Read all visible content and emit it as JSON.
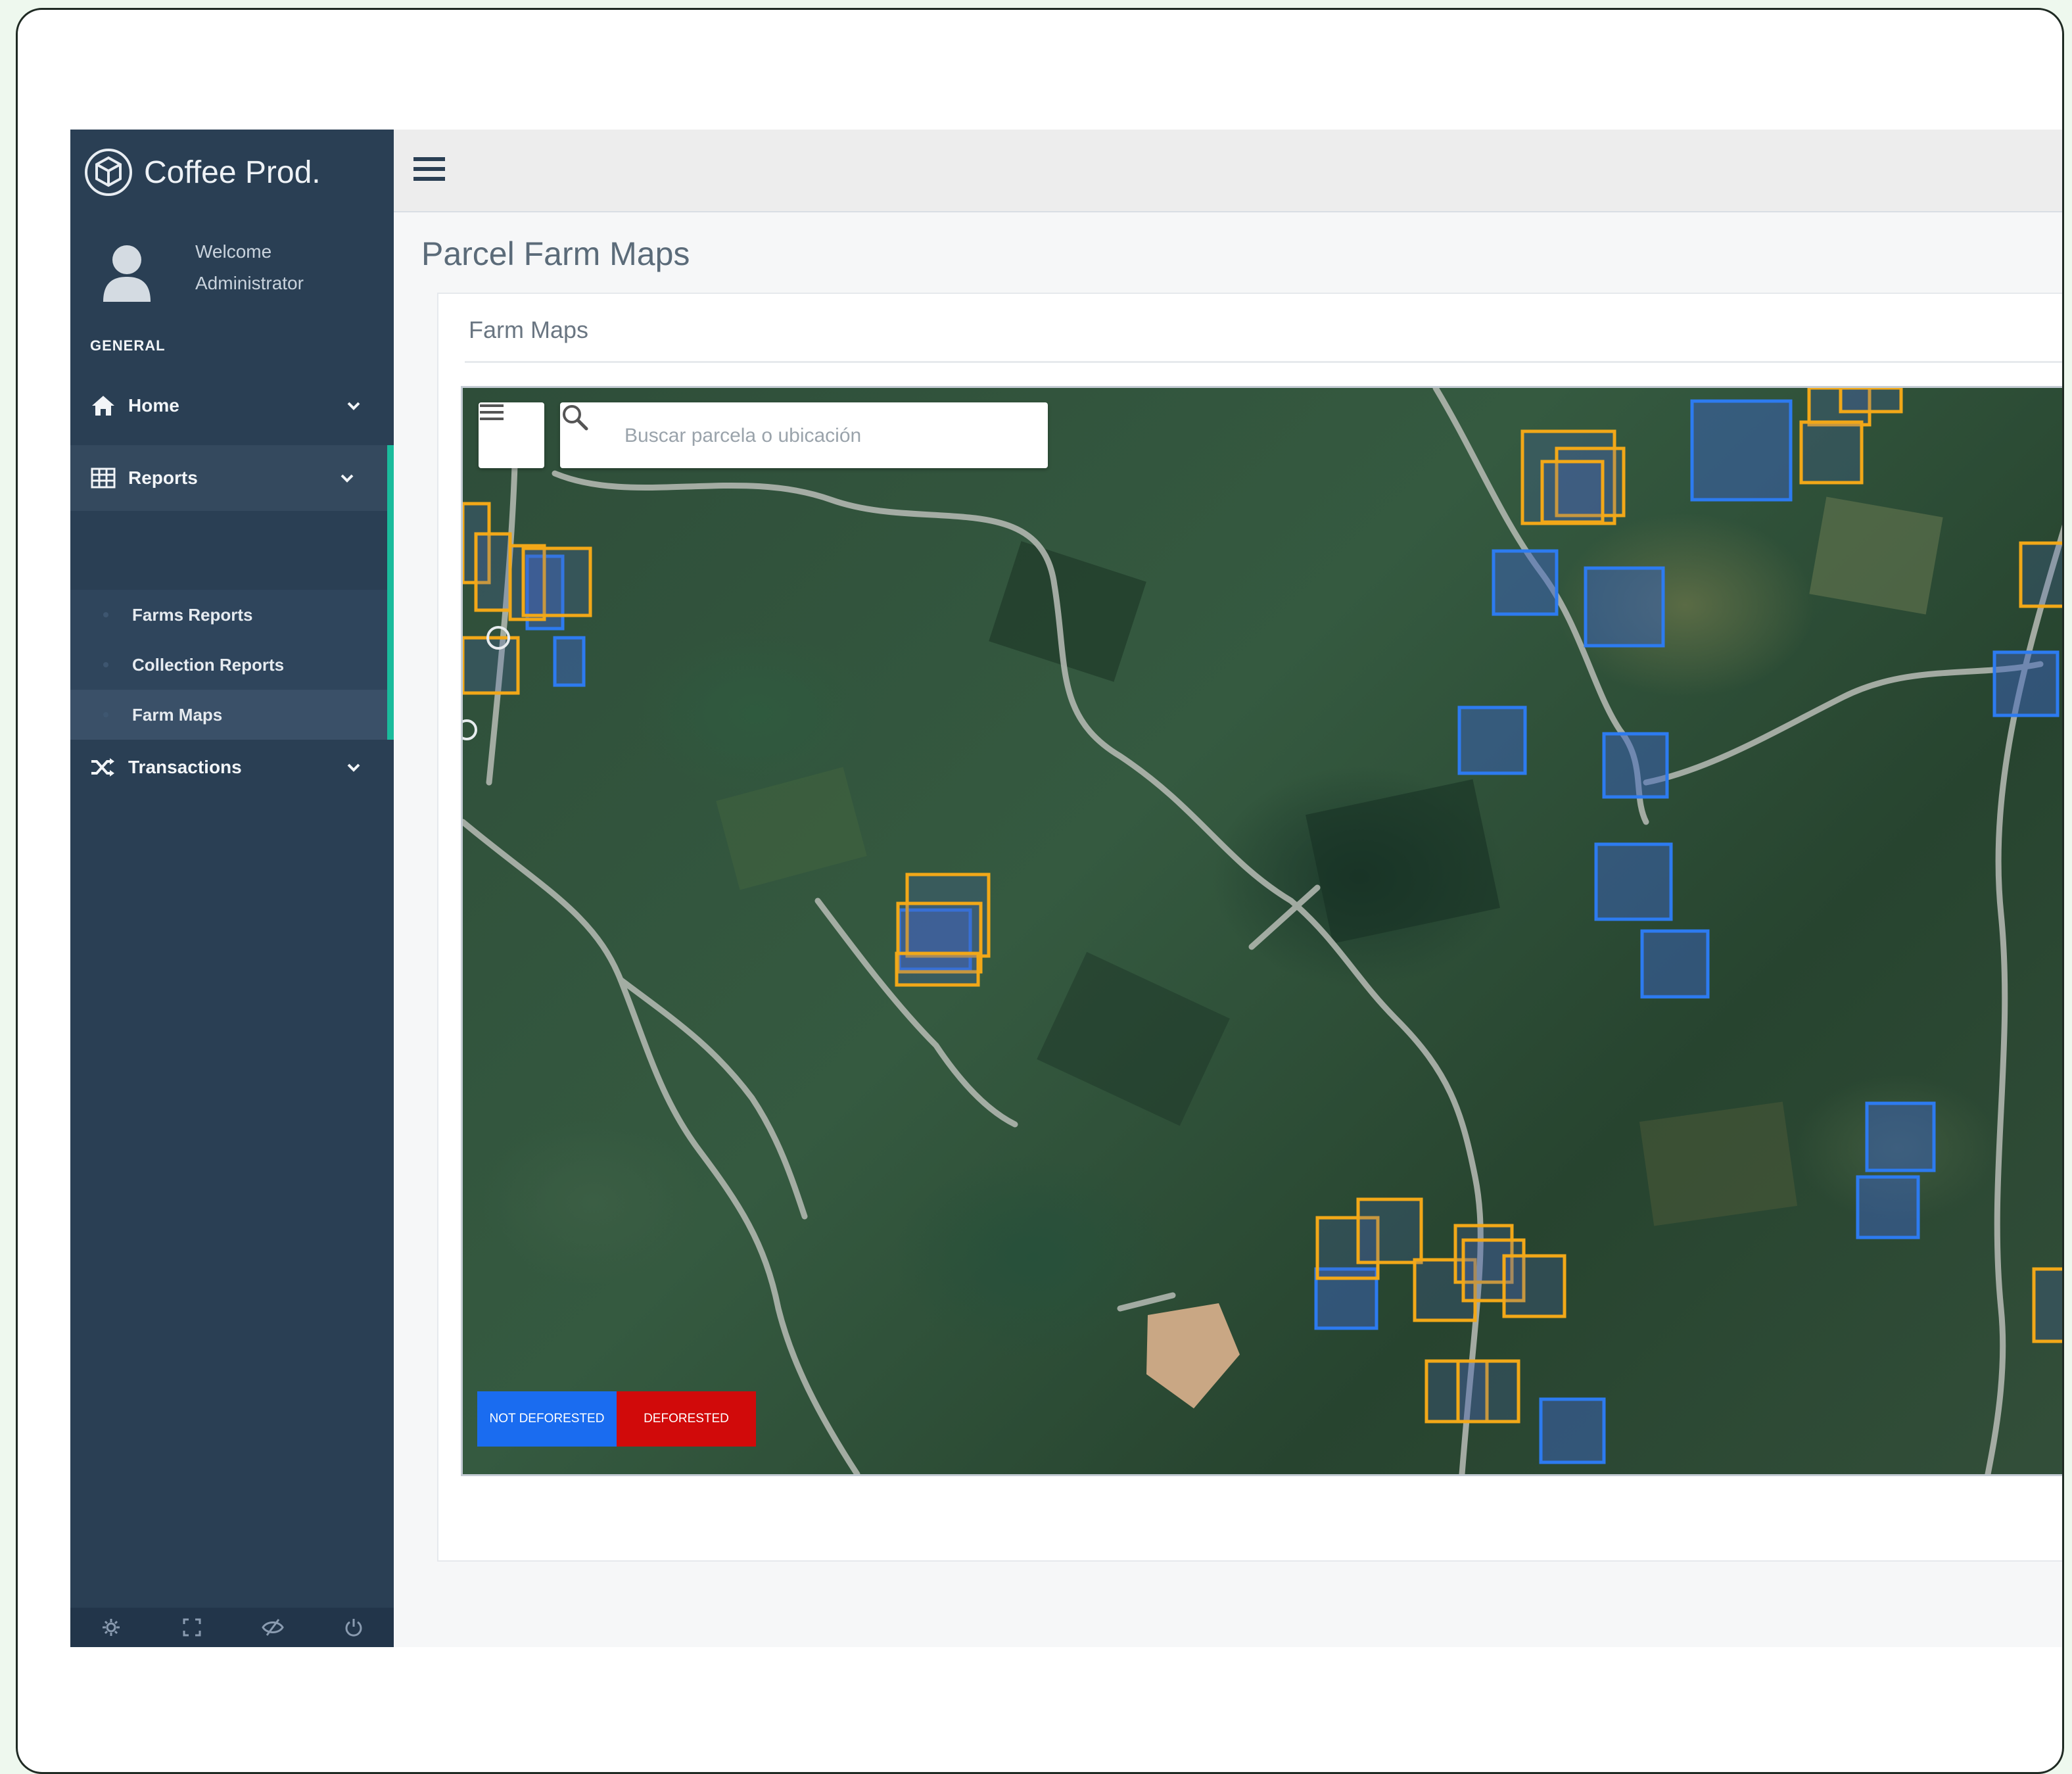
{
  "app": {
    "brand": "Coffee Prod."
  },
  "user": {
    "welcome": "Welcome",
    "name": "Administrator"
  },
  "sidebar": {
    "section": "GENERAL",
    "items": [
      {
        "label": "Home",
        "icon": "home-icon"
      },
      {
        "label": "Reports",
        "icon": "table-icon",
        "children": [
          "Farms Reports",
          "Collection Reports",
          "Farm Maps"
        ]
      },
      {
        "label": "Transactions",
        "icon": "shuffle-icon"
      }
    ],
    "footer_icons": [
      "gear-icon",
      "fullscreen-icon",
      "eye-slash-icon",
      "power-icon"
    ]
  },
  "page": {
    "title": "Parcel Farm Maps",
    "panel_title": "Farm Maps"
  },
  "map": {
    "search_placeholder": "Buscar parcela o ubicación",
    "legend": {
      "not_deforested": "NOT DEFORESTED",
      "deforested": "DEFORESTED"
    },
    "colors": {
      "not_deforested": "#1a6cf0",
      "deforested": "#d10a0a",
      "parcel_outline_blue": "#2d7bf0",
      "parcel_outline_orange": "#f2a818"
    }
  }
}
